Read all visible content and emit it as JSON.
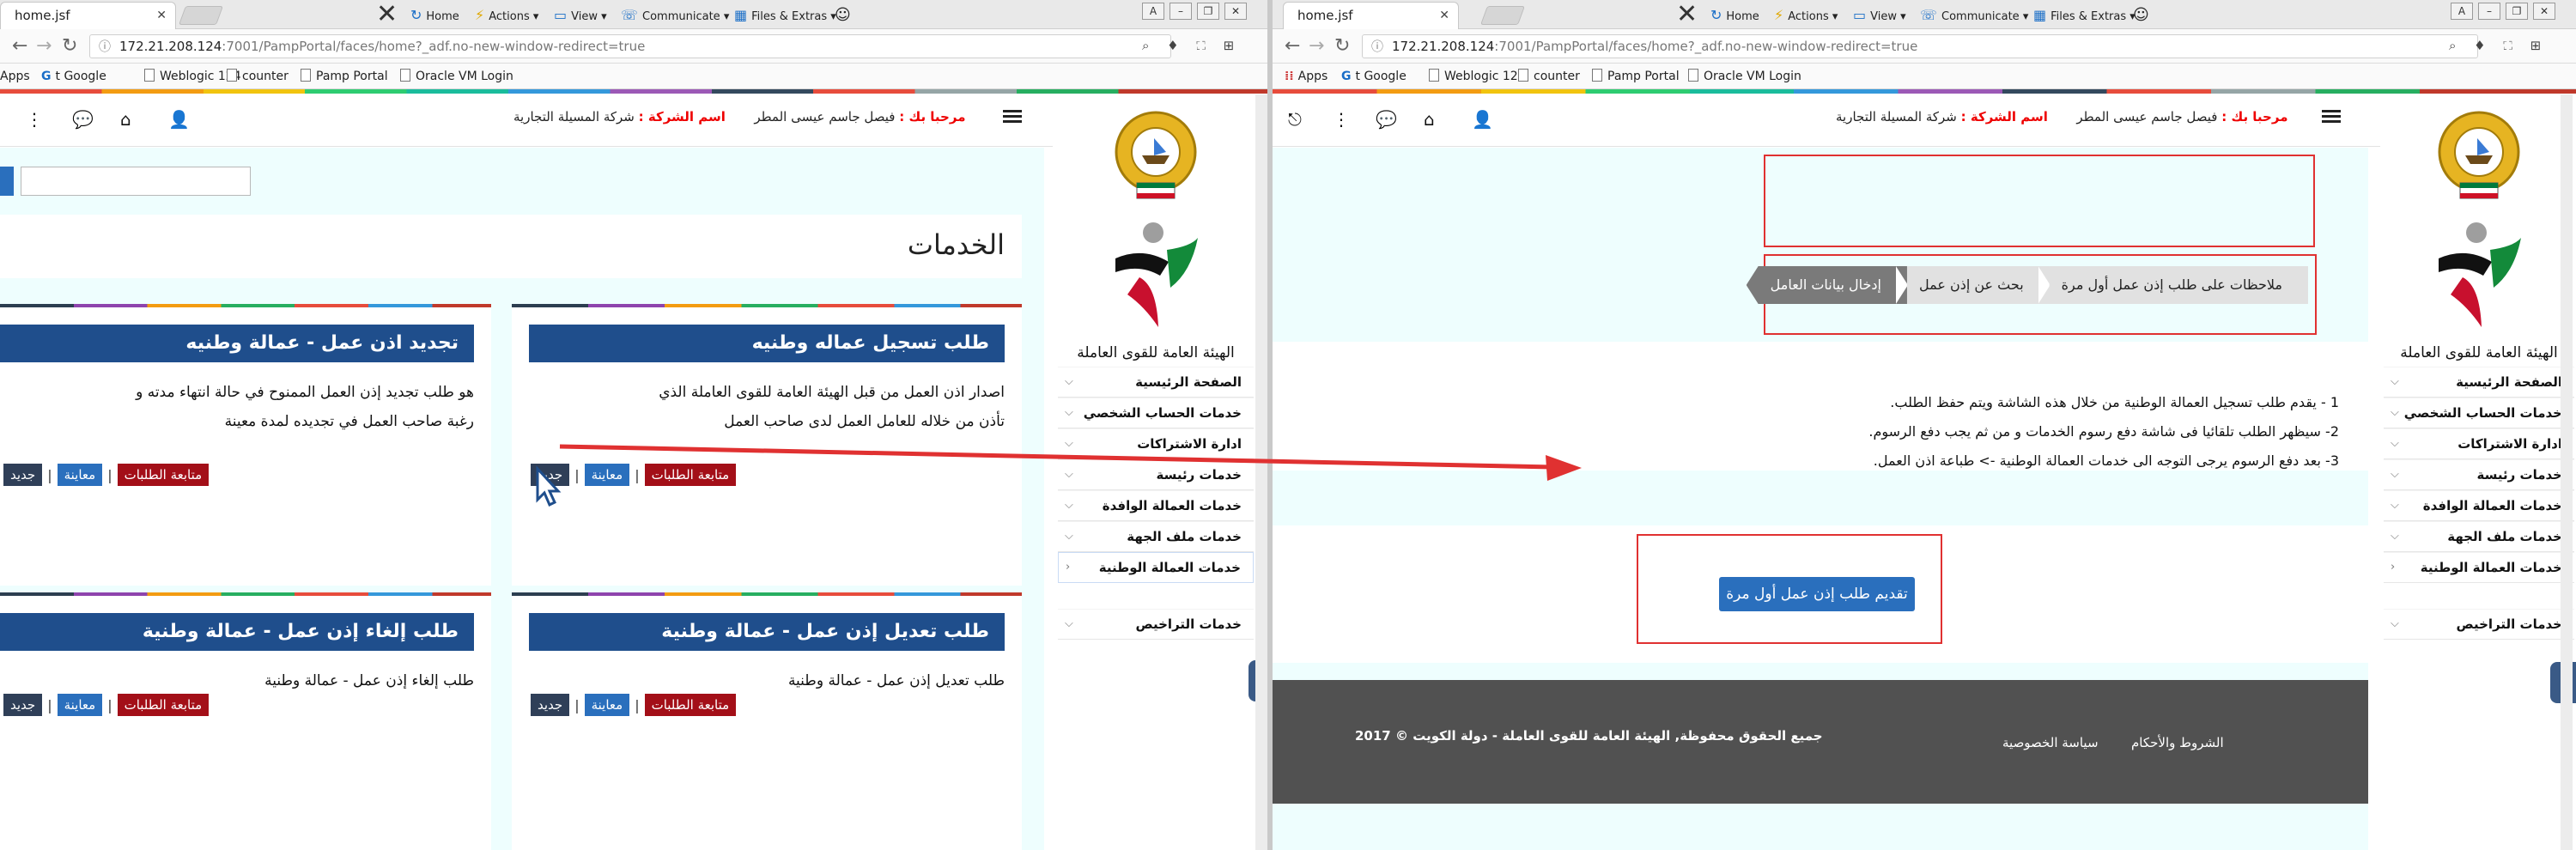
{
  "left": {
    "tab": {
      "title": "home.jsf"
    },
    "toolbar": {
      "home": "Home",
      "actions": "Actions",
      "view": "View",
      "communicate": "Communicate",
      "files": "Files & Extras"
    },
    "url": {
      "host": "172.21.208.124",
      "rest": ":7001/PampPortal/faces/home?_adf.no-new-window-redirect=true"
    },
    "bookmarks": [
      "Apps",
      "t Google",
      "Weblogic 124",
      "counter",
      "Pamp Portal",
      "Oracle VM Login"
    ],
    "header": {
      "welcome_label": "مرحبا بك :",
      "user": "فيصل جاسم عيسى المطر",
      "company_label": "اسم الشركة :",
      "company": "شركة المسيلة التجارية"
    },
    "services_title": "الخدمات",
    "cards": [
      {
        "title": "طلب تسجيل عماله وطنيه",
        "desc": "اصدار اذن العمل من قبل الهيئة العامة للقوى العاملة الذي تأذن من خلاله للعامل العمل لدى صاحب العمل",
        "b1": "متابعة الطلبات",
        "b2": "معاينة",
        "b3": "جديد"
      },
      {
        "title": "تجديد اذن عمل - عمالة وطنيه",
        "desc": "هو طلب تجديد إذن العمل الممنوح في حالة انتهاء مدته و رغبة صاحب العمل في تجديده لمدة معينة",
        "b1": "متابعة الطلبات",
        "b2": "معاينة",
        "b3": "جديد"
      },
      {
        "title": "طلب تعديل إذن عمل - عمالة وطنية",
        "desc": "طلب تعديل إذن عمل - عمالة وطنية",
        "b1": "متابعة الطلبات",
        "b2": "معاينة",
        "b3": "جديد"
      },
      {
        "title": "طلب إلغاء إذن عمل - عمالة وطنية",
        "desc": "طلب إلغاء إذن عمل - عمالة وطنية",
        "b1": "متابعة الطلبات",
        "b2": "معاينة",
        "b3": "جديد"
      }
    ]
  },
  "right": {
    "tab": {
      "title": "home.jsf"
    },
    "toolbar": {
      "home": "Home",
      "actions": "Actions",
      "view": "View",
      "communicate": "Communicate",
      "files": "Files & Extras"
    },
    "url": {
      "host": "172.21.208.124",
      "rest": ":7001/PampPortal/faces/home?_adf.no-new-window-redirect=true"
    },
    "bookmarks": [
      "Apps",
      "t Google",
      "Weblogic 124",
      "counter",
      "Pamp Portal",
      "Oracle VM Login"
    ],
    "header": {
      "welcome_label": "مرحبا بك :",
      "user": "فيصل جاسم عيسى المطر",
      "company_label": "اسم الشركة :",
      "company": "شركة المسيلة التجارية"
    },
    "steps": [
      "ملاحظات على طلب إذن عمل أول مرة",
      "بحث عن إذن عمل",
      "إدخال بيانات العامل"
    ],
    "notes": [
      "1 - يقدم طلب تسجيل العمالة الوطنية من خلال هذه الشاشة ويتم حفظ الطلب.",
      "2- سيظهر الطلب تلقائيا فى شاشة دفع رسوم الخدمات و من ثم يجب دفع الرسوم.",
      "3- بعد دفع الرسوم يرجى التوجه الى خدمات العمالة الوطنية -> طباعة اذن العمل."
    ],
    "submit_label": "تقديم طلب إذن عمل أول مرة",
    "footer": {
      "copyright": "جميع الحقوق محفوظة, الهيئة العامة للقوى العاملة - دولة الكويت © 2017",
      "privacy": "سياسة الخصوصية",
      "terms": "الشروط والأحكام"
    }
  },
  "sidebar": {
    "org_name": "الهيئة العامة للقوى العاملة",
    "menu": [
      "الصفحة الرئيسية",
      "خدمات الحساب الشخصي",
      "ادارة الاشتراكات",
      "خدمات رئيسة",
      "خدمات العمالة الوافدة",
      "خدمات ملف الجهة",
      "خدمات العمالة الوطنية",
      "خدمات التراخيص"
    ]
  },
  "colors": {
    "accent_blue": "#1f4e8c",
    "button_red": "#a30f18",
    "button_blue": "#2a6fbd",
    "highlight_red": "#e03131",
    "content_bg": "#eefefe"
  }
}
